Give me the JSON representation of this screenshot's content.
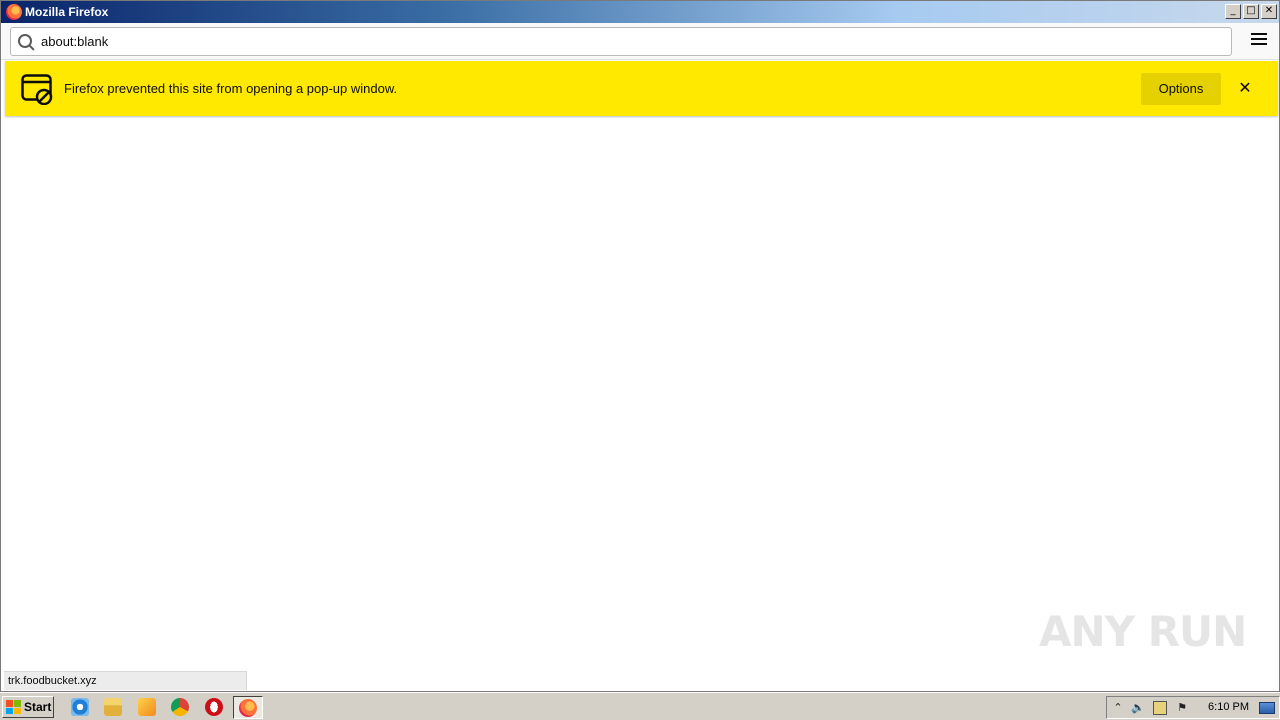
{
  "window": {
    "title": "Mozilla Firefox",
    "controls": {
      "minimize": "_",
      "maximize": "□",
      "close": "✕"
    }
  },
  "navbar": {
    "url": "about:blank",
    "search_icon": "search-icon",
    "menu_icon": "hamburger-menu-icon"
  },
  "notification": {
    "icon": "popup-blocked-icon",
    "message": "Firefox prevented this site from opening a pop-up window.",
    "options_label": "Options",
    "close_glyph": "✕",
    "background": "#ffe900"
  },
  "status": {
    "link": "trk.foodbucket.xyz"
  },
  "watermark": {
    "text": "ANY RUN"
  },
  "taskbar": {
    "start_label": "Start",
    "pinned": [
      "internet-explorer-icon",
      "file-explorer-icon",
      "media-player-icon",
      "chrome-icon",
      "opera-icon",
      "firefox-icon"
    ],
    "tray": {
      "clock": "6:10 PM",
      "chevron": "⌃",
      "volume": "🔈",
      "flag": "⚑"
    }
  }
}
